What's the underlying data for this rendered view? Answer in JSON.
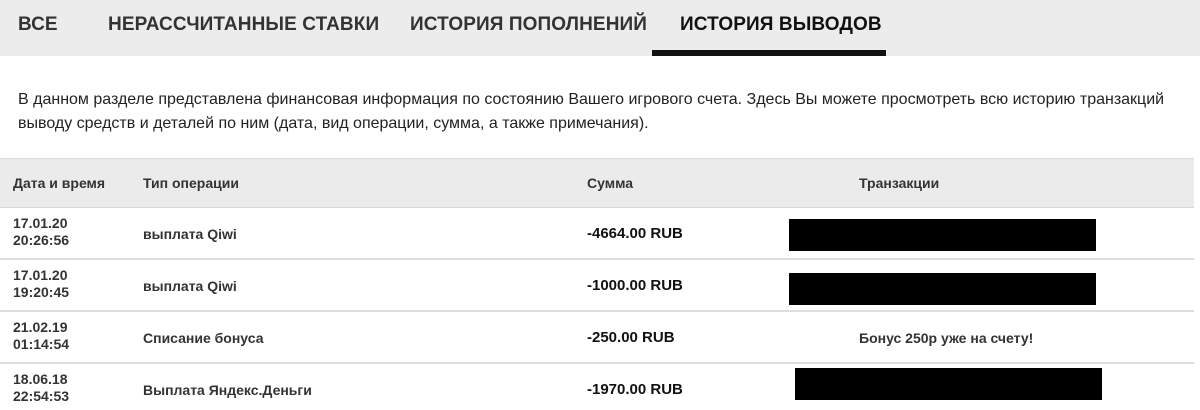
{
  "tabs": [
    {
      "label": "ВСЕ"
    },
    {
      "label": "НЕРАССЧИТАННЫЕ СТАВКИ"
    },
    {
      "label": "ИСТОРИЯ ПОПОЛНЕНИЙ"
    },
    {
      "label": "ИСТОРИЯ ВЫВОДОВ",
      "active": true
    }
  ],
  "description": {
    "line1": "В данном разделе представлена финансовая информация по состоянию Вашего игрового счета. Здесь Вы можете просмотреть всю историю транзакций",
    "line2": "выводу средств и деталей по ним (дата, вид операции, сумма, а также примечания)."
  },
  "table": {
    "headers": {
      "date": "Дата и время",
      "type": "Тип операции",
      "sum": "Сумма",
      "transactions": "Транзакции"
    },
    "rows": [
      {
        "date": "17.01.20",
        "time": "20:26:56",
        "type": "выплата Qiwi",
        "sum": "-4664.00 RUB",
        "note": "",
        "redacted": true
      },
      {
        "date": "17.01.20",
        "time": "19:20:45",
        "type": "выплата Qiwi",
        "sum": "-1000.00 RUB",
        "note": "",
        "redacted": true
      },
      {
        "date": "21.02.19",
        "time": "01:14:54",
        "type": "Списание бонуса",
        "sum": "-250.00 RUB",
        "note": "Бонус 250р уже на счету!",
        "redacted": false
      },
      {
        "date": "18.06.18",
        "time": "22:54:53",
        "type": "Выплата Яндекс.Деньги",
        "sum": "-1970.00 RUB",
        "note": "",
        "redacted": true
      }
    ]
  }
}
